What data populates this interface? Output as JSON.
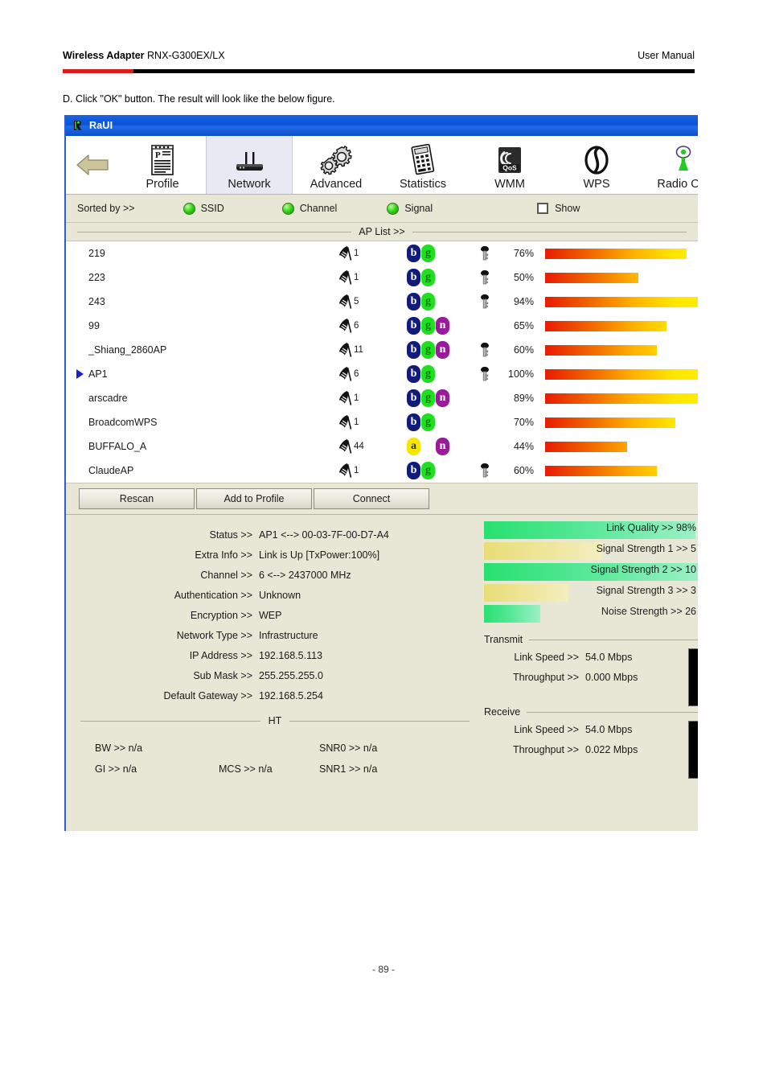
{
  "document": {
    "header_left_bold": "Wireless Adapter",
    "header_left_model": " RNX-G300EX/LX",
    "header_right": "User Manual",
    "instruction": "D. Click \"OK\" button. The result will look like the below figure.",
    "page_number": "- 89 -",
    "rule_color": "#000000",
    "rule_accent_color": "#d91c1c"
  },
  "app": {
    "title": "RaUI",
    "title_icon": "raui-logo-icon",
    "titlebar_color": "#0a53d8",
    "toolbar": {
      "back_icon": "back-arrow-icon",
      "items": [
        {
          "label": "Profile",
          "icon": "profile-icon",
          "selected": false
        },
        {
          "label": "Network",
          "icon": "network-icon",
          "selected": true
        },
        {
          "label": "Advanced",
          "icon": "gear-icon",
          "selected": false
        },
        {
          "label": "Statistics",
          "icon": "calculator-icon",
          "selected": false
        },
        {
          "label": "WMM",
          "icon": "qos-icon",
          "selected": false
        },
        {
          "label": "WPS",
          "icon": "wps-icon",
          "selected": false
        },
        {
          "label": "Radio On/",
          "icon": "radio-antenna-icon",
          "selected": false
        }
      ]
    },
    "sortbar": {
      "label": "Sorted by >>",
      "options": [
        {
          "label": "SSID",
          "icon": "green-led-icon"
        },
        {
          "label": "Channel",
          "icon": "green-led-icon"
        },
        {
          "label": "Signal",
          "icon": "green-led-icon"
        }
      ],
      "show_checkbox_label": "Show",
      "show_checkbox_checked": false
    },
    "ap_list_header": "AP List >>",
    "ap_list": {
      "columns": [
        "ssid",
        "channel",
        "bands",
        "security",
        "signal_percent",
        "signal_bar"
      ],
      "rows": [
        {
          "ssid": "219",
          "channel": "1",
          "bands": [
            "b",
            "g"
          ],
          "secured": true,
          "signal": "76%",
          "signal_value": 76,
          "selected": false
        },
        {
          "ssid": "223",
          "channel": "1",
          "bands": [
            "b",
            "g"
          ],
          "secured": true,
          "signal": "50%",
          "signal_value": 50,
          "selected": false
        },
        {
          "ssid": "243",
          "channel": "5",
          "bands": [
            "b",
            "g"
          ],
          "secured": true,
          "signal": "94%",
          "signal_value": 94,
          "selected": false
        },
        {
          "ssid": "99",
          "channel": "6",
          "bands": [
            "b",
            "g",
            "n"
          ],
          "secured": false,
          "signal": "65%",
          "signal_value": 65,
          "selected": false
        },
        {
          "ssid": "_Shiang_2860AP",
          "channel": "11",
          "bands": [
            "b",
            "g",
            "n"
          ],
          "secured": true,
          "signal": "60%",
          "signal_value": 60,
          "selected": false
        },
        {
          "ssid": "AP1",
          "channel": "6",
          "bands": [
            "b",
            "g"
          ],
          "secured": true,
          "signal": "100%",
          "signal_value": 100,
          "selected": true
        },
        {
          "ssid": "arscadre",
          "channel": "1",
          "bands": [
            "b",
            "g",
            "n"
          ],
          "secured": false,
          "signal": "89%",
          "signal_value": 89,
          "selected": false
        },
        {
          "ssid": "BroadcomWPS",
          "channel": "1",
          "bands": [
            "b",
            "g"
          ],
          "secured": false,
          "signal": "70%",
          "signal_value": 70,
          "selected": false
        },
        {
          "ssid": "BUFFALO_A",
          "channel": "44",
          "bands": [
            "a",
            "_",
            "n"
          ],
          "secured": false,
          "signal": "44%",
          "signal_value": 44,
          "selected": false
        },
        {
          "ssid": "ClaudeAP",
          "channel": "1",
          "bands": [
            "b",
            "g"
          ],
          "secured": true,
          "signal": "60%",
          "signal_value": 60,
          "selected": false
        }
      ]
    },
    "buttons": [
      {
        "label": "Rescan"
      },
      {
        "label": "Add to Profile"
      },
      {
        "label": "Connect"
      }
    ],
    "status": {
      "rows": [
        {
          "key": "Status >>",
          "value": "AP1 <--> 00-03-7F-00-D7-A4"
        },
        {
          "key": "Extra Info >>",
          "value": "Link is Up [TxPower:100%]"
        },
        {
          "key": "Channel >>",
          "value": "6 <--> 2437000 MHz"
        },
        {
          "key": "Authentication >>",
          "value": "Unknown"
        },
        {
          "key": "Encryption >>",
          "value": "WEP"
        },
        {
          "key": "Network Type >>",
          "value": "Infrastructure"
        },
        {
          "key": "IP Address >>",
          "value": "192.168.5.113"
        },
        {
          "key": "Sub Mask >>",
          "value": "255.255.255.0"
        },
        {
          "key": "Default Gateway >>",
          "value": "192.168.5.254"
        }
      ],
      "ht_divider_label": "HT",
      "ht": {
        "bw": "BW >> n/a",
        "gi": "GI >> n/a",
        "mcs": "MCS >> n/a",
        "snr0": "SNR0 >> n/a",
        "snr1": "SNR1 >> n/a"
      },
      "quality_bars": [
        {
          "label": "Link Quality >> 98%",
          "value": 98,
          "color": "green"
        },
        {
          "label": "Signal Strength 1 >> 5",
          "value": 55,
          "color": "yellow"
        },
        {
          "label": "Signal Strength 2 >> 10",
          "value": 100,
          "color": "green"
        },
        {
          "label": "Signal Strength 3 >> 3",
          "value": 39,
          "color": "yellow"
        },
        {
          "label": "Noise Strength >> 26",
          "value": 26,
          "color": "green"
        }
      ],
      "transmit": {
        "title": "Transmit",
        "link_speed_key": "Link Speed >>",
        "link_speed_value": "54.0 Mbps",
        "throughput_key": "Throughput >>",
        "throughput_value": "0.000 Mbps"
      },
      "receive": {
        "title": "Receive",
        "link_speed_key": "Link Speed >>",
        "link_speed_value": "54.0 Mbps",
        "throughput_key": "Throughput >>",
        "throughput_value": "0.022 Mbps"
      }
    }
  }
}
